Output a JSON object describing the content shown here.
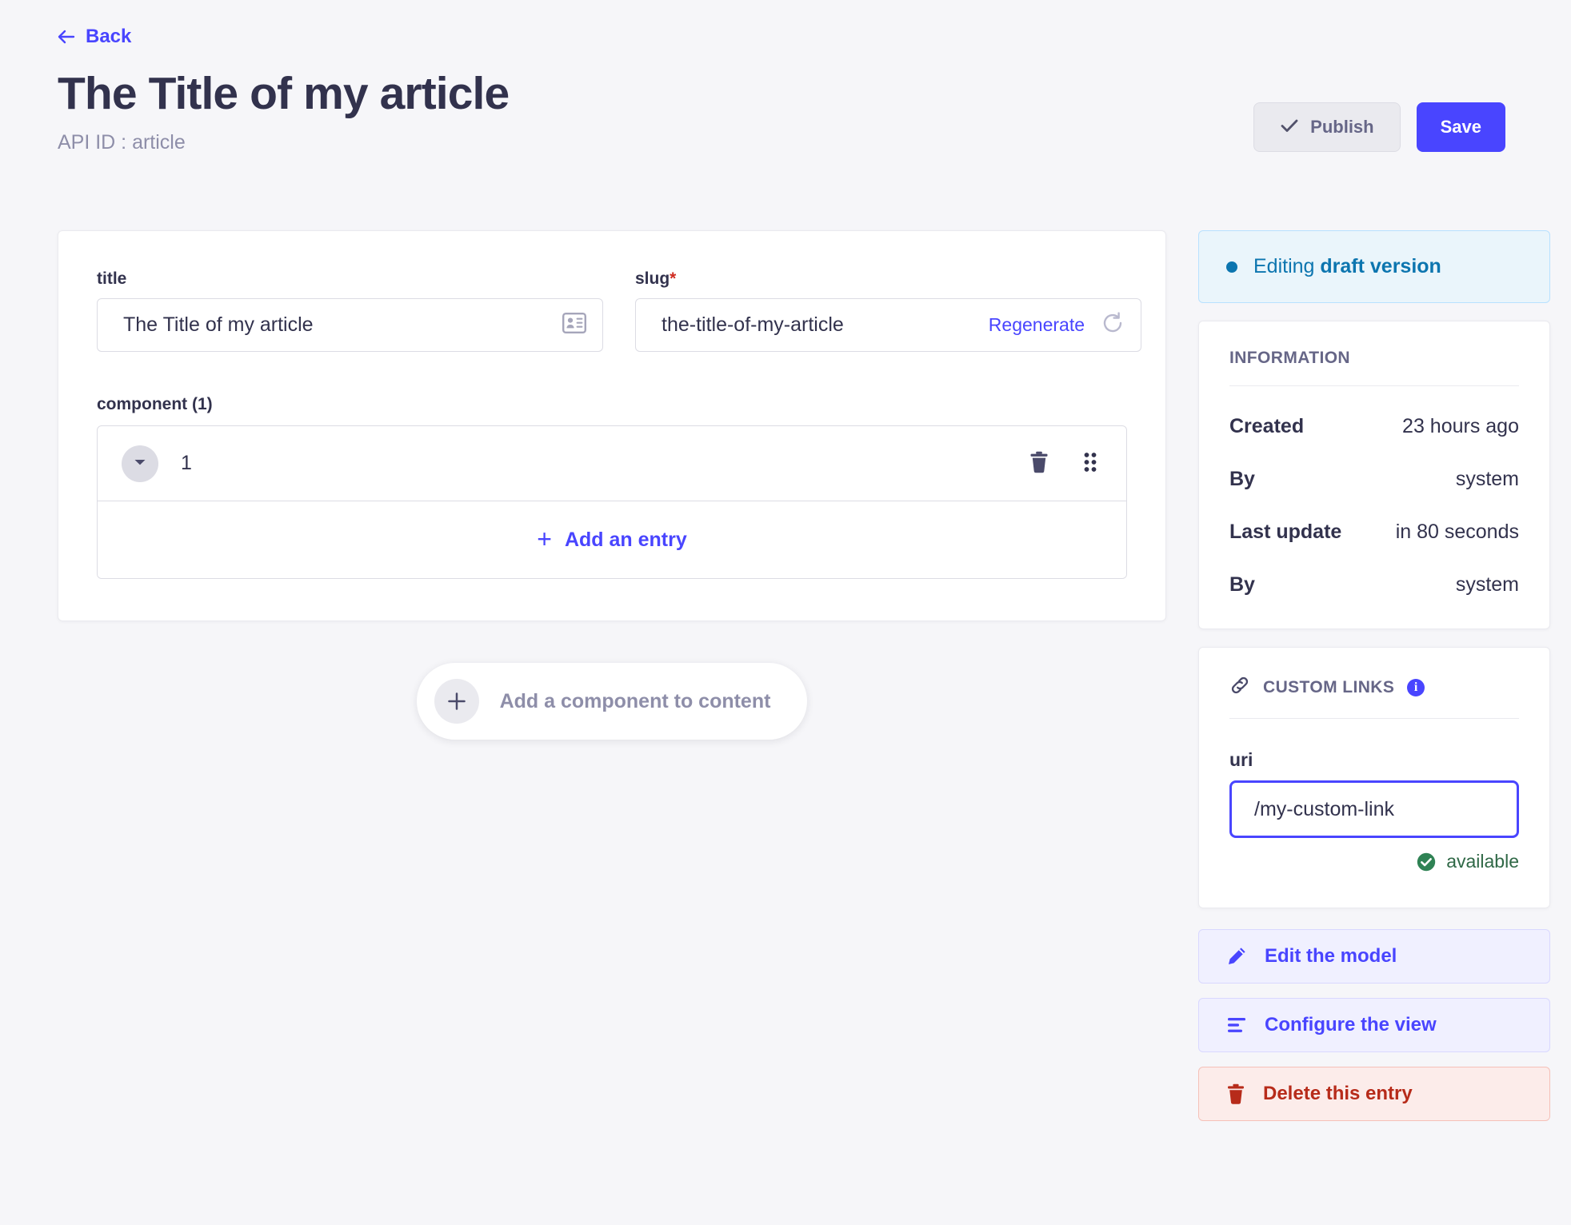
{
  "header": {
    "back_label": "Back",
    "title": "The Title of my article",
    "api_id": "API ID : article",
    "publish_label": "Publish",
    "save_label": "Save"
  },
  "form": {
    "title_field": {
      "label": "title",
      "value": "The Title of my article"
    },
    "slug_field": {
      "label": "slug",
      "required_marker": "*",
      "value": "the-title-of-my-article",
      "regenerate_label": "Regenerate"
    },
    "component_field": {
      "label": "component (1)",
      "entries": [
        {
          "index": "1"
        }
      ],
      "add_entry_label": "Add an entry",
      "plus": "+"
    },
    "add_component_label": "Add a component to content"
  },
  "sidebar": {
    "draft_banner": {
      "prefix": "Editing ",
      "emphasis": "draft version"
    },
    "information": {
      "heading": "INFORMATION",
      "rows": [
        {
          "key": "Created",
          "value": "23 hours ago"
        },
        {
          "key": "By",
          "value": "system"
        },
        {
          "key": "Last update",
          "value": "in 80 seconds"
        },
        {
          "key": "By",
          "value": "system"
        }
      ]
    },
    "custom_links": {
      "heading": "CUSTOM LINKS",
      "info_badge": "i",
      "uri_label": "uri",
      "uri_value": "/my-custom-link",
      "availability_label": "available"
    },
    "actions": [
      {
        "label": "Edit the model",
        "icon": "pencil-icon",
        "variant": "primary"
      },
      {
        "label": "Configure the view",
        "icon": "layout-list-icon",
        "variant": "primary"
      },
      {
        "label": "Delete this entry",
        "icon": "trash-icon",
        "variant": "danger"
      }
    ]
  },
  "colors": {
    "page_bg": "#f6f6f9",
    "accent": "#4945ff",
    "text": "#32324d",
    "muted": "#8e8ea9",
    "danger": "#b72b1a",
    "success": "#2f6846",
    "draft_blue": "#0c75af"
  }
}
